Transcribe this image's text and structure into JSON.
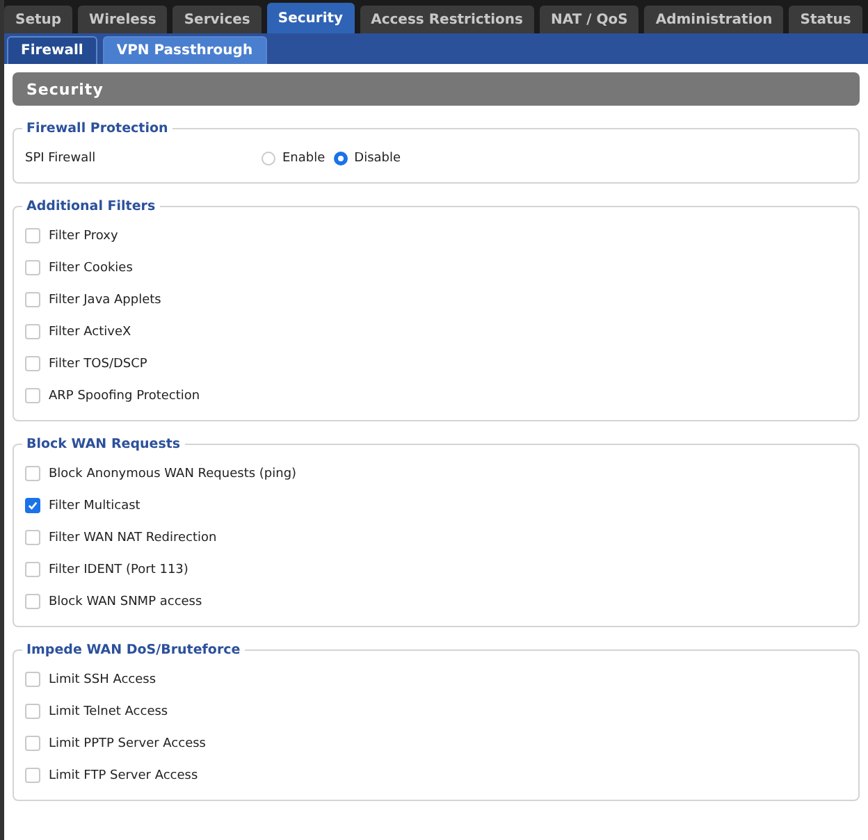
{
  "tabs": [
    {
      "label": "Setup",
      "selected": false
    },
    {
      "label": "Wireless",
      "selected": false
    },
    {
      "label": "Services",
      "selected": false
    },
    {
      "label": "Security",
      "selected": true
    },
    {
      "label": "Access Restrictions",
      "selected": false
    },
    {
      "label": "NAT / QoS",
      "selected": false
    },
    {
      "label": "Administration",
      "selected": false
    },
    {
      "label": "Status",
      "selected": false
    }
  ],
  "subtabs": [
    {
      "label": "Firewall",
      "selected": true
    },
    {
      "label": "VPN Passthrough",
      "selected": false
    }
  ],
  "section_title": "Security",
  "fieldsets": [
    {
      "legend": "Firewall Protection",
      "rows": [
        {
          "kind": "radio",
          "label": "SPI Firewall",
          "options": [
            {
              "label": "Enable",
              "selected": false
            },
            {
              "label": "Disable",
              "selected": true
            }
          ]
        }
      ]
    },
    {
      "legend": "Additional Filters",
      "rows": [
        {
          "kind": "checkbox",
          "label": "Filter Proxy",
          "checked": false
        },
        {
          "kind": "checkbox",
          "label": "Filter Cookies",
          "checked": false
        },
        {
          "kind": "checkbox",
          "label": "Filter Java Applets",
          "checked": false
        },
        {
          "kind": "checkbox",
          "label": "Filter ActiveX",
          "checked": false
        },
        {
          "kind": "checkbox",
          "label": "Filter TOS/DSCP",
          "checked": false
        },
        {
          "kind": "checkbox",
          "label": "ARP Spoofing Protection",
          "checked": false
        }
      ]
    },
    {
      "legend": "Block WAN Requests",
      "rows": [
        {
          "kind": "checkbox",
          "label": "Block Anonymous WAN Requests (ping)",
          "checked": false
        },
        {
          "kind": "checkbox",
          "label": "Filter Multicast",
          "checked": true
        },
        {
          "kind": "checkbox",
          "label": "Filter WAN NAT Redirection",
          "checked": false
        },
        {
          "kind": "checkbox",
          "label": "Filter IDENT (Port 113)",
          "checked": false
        },
        {
          "kind": "checkbox",
          "label": "Block WAN SNMP access",
          "checked": false
        }
      ]
    },
    {
      "legend": "Impede WAN DoS/Bruteforce",
      "rows": [
        {
          "kind": "checkbox",
          "label": "Limit SSH Access",
          "checked": false
        },
        {
          "kind": "checkbox",
          "label": "Limit Telnet Access",
          "checked": false
        },
        {
          "kind": "checkbox",
          "label": "Limit PPTP Server Access",
          "checked": false
        },
        {
          "kind": "checkbox",
          "label": "Limit FTP Server Access",
          "checked": false
        }
      ]
    }
  ]
}
